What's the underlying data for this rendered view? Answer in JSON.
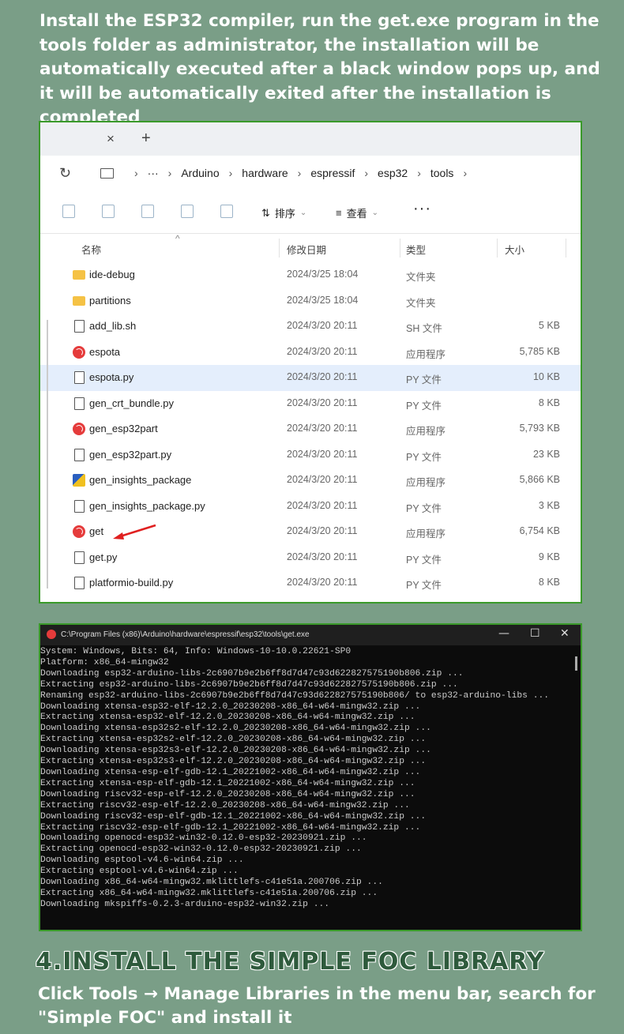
{
  "intro_text": "Install the ESP32 compiler, run the get.exe program in the tools folder as administrator, the installation will be automatically executed after a black window pops up, and it will be automatically exited after the installation is completed",
  "explorer": {
    "tab": {
      "close_glyph": "×",
      "new_glyph": "+"
    },
    "breadcrumbs": [
      "···",
      "Arduino",
      "hardware",
      "espressif",
      "esp32",
      "tools"
    ],
    "toolbar": {
      "sort_label": "排序",
      "view_label": "查看",
      "more_label": "···"
    },
    "columns": {
      "name": "名称",
      "date": "修改日期",
      "type": "类型",
      "size": "大小"
    },
    "files": [
      {
        "icon": "folder-icon",
        "name": "ide-debug",
        "date": "2024/3/25 18:04",
        "type": "文件夹",
        "size": ""
      },
      {
        "icon": "folder-icon",
        "name": "partitions",
        "date": "2024/3/25 18:04",
        "type": "文件夹",
        "size": ""
      },
      {
        "icon": "file-icon",
        "name": "add_lib.sh",
        "date": "2024/3/20 20:11",
        "type": "SH 文件",
        "size": "5 KB"
      },
      {
        "icon": "espressif-app-icon",
        "name": "espota",
        "date": "2024/3/20 20:11",
        "type": "应用程序",
        "size": "5,785 KB"
      },
      {
        "icon": "file-icon",
        "name": "espota.py",
        "date": "2024/3/20 20:11",
        "type": "PY 文件",
        "size": "10 KB",
        "selected": true
      },
      {
        "icon": "file-icon",
        "name": "gen_crt_bundle.py",
        "date": "2024/3/20 20:11",
        "type": "PY 文件",
        "size": "8 KB"
      },
      {
        "icon": "espressif-app-icon",
        "name": "gen_esp32part",
        "date": "2024/3/20 20:11",
        "type": "应用程序",
        "size": "5,793 KB"
      },
      {
        "icon": "file-icon",
        "name": "gen_esp32part.py",
        "date": "2024/3/20 20:11",
        "type": "PY 文件",
        "size": "23 KB"
      },
      {
        "icon": "package-app-icon",
        "name": "gen_insights_package",
        "date": "2024/3/20 20:11",
        "type": "应用程序",
        "size": "5,866 KB"
      },
      {
        "icon": "file-icon",
        "name": "gen_insights_package.py",
        "date": "2024/3/20 20:11",
        "type": "PY 文件",
        "size": "3 KB"
      },
      {
        "icon": "espressif-app-icon",
        "name": "get",
        "date": "2024/3/20 20:11",
        "type": "应用程序",
        "size": "6,754 KB"
      },
      {
        "icon": "file-icon",
        "name": "get.py",
        "date": "2024/3/20 20:11",
        "type": "PY 文件",
        "size": "9 KB"
      },
      {
        "icon": "file-icon",
        "name": "platformio-build.py",
        "date": "2024/3/20 20:11",
        "type": "PY 文件",
        "size": "8 KB"
      }
    ]
  },
  "console": {
    "title": "C:\\Program Files (x86)\\Arduino\\hardware\\espressif\\esp32\\tools\\get.exe",
    "controls": {
      "minimize": "—",
      "maximize": "☐",
      "close": "✕"
    },
    "lines": [
      "System: Windows, Bits: 64, Info: Windows-10-10.0.22621-SP0",
      "Platform: x86_64-mingw32",
      "Downloading esp32-arduino-libs-2c6907b9e2b6ff8d7d47c93d622827575190b806.zip ...",
      "Extracting esp32-arduino-libs-2c6907b9e2b6ff8d7d47c93d622827575190b806.zip ...",
      "Renaming esp32-arduino-libs-2c6907b9e2b6ff8d7d47c93d622827575190b806/ to esp32-arduino-libs ...",
      "Downloading xtensa-esp32-elf-12.2.0_20230208-x86_64-w64-mingw32.zip ...",
      "Extracting xtensa-esp32-elf-12.2.0_20230208-x86_64-w64-mingw32.zip ...",
      "Downloading xtensa-esp32s2-elf-12.2.0_20230208-x86_64-w64-mingw32.zip ...",
      "Extracting xtensa-esp32s2-elf-12.2.0_20230208-x86_64-w64-mingw32.zip ...",
      "Downloading xtensa-esp32s3-elf-12.2.0_20230208-x86_64-w64-mingw32.zip ...",
      "Extracting xtensa-esp32s3-elf-12.2.0_20230208-x86_64-w64-mingw32.zip ...",
      "Downloading xtensa-esp-elf-gdb-12.1_20221002-x86_64-w64-mingw32.zip ...",
      "Extracting xtensa-esp-elf-gdb-12.1_20221002-x86_64-w64-mingw32.zip ...",
      "Downloading riscv32-esp-elf-12.2.0_20230208-x86_64-w64-mingw32.zip ...",
      "Extracting riscv32-esp-elf-12.2.0_20230208-x86_64-w64-mingw32.zip ...",
      "Downloading riscv32-esp-elf-gdb-12.1_20221002-x86_64-w64-mingw32.zip ...",
      "Extracting riscv32-esp-elf-gdb-12.1_20221002-x86_64-w64-mingw32.zip ...",
      "Downloading openocd-esp32-win32-0.12.0-esp32-20230921.zip ...",
      "Extracting openocd-esp32-win32-0.12.0-esp32-20230921.zip ...",
      "Downloading esptool-v4.6-win64.zip ...",
      "Extracting esptool-v4.6-win64.zip ...",
      "Downloading x86_64-w64-mingw32.mklittlefs-c41e51a.200706.zip ...",
      "Extracting x86_64-w64-mingw32.mklittlefs-c41e51a.200706.zip ...",
      "Downloading mkspiffs-0.2.3-arduino-esp32-win32.zip ..."
    ]
  },
  "section_heading": "4.INSTALL THE SIMPLE FOC LIBRARY",
  "section_note": "Click Tools → Manage Libraries in the menu bar, search for\n \"Simple FOC\" and install it"
}
